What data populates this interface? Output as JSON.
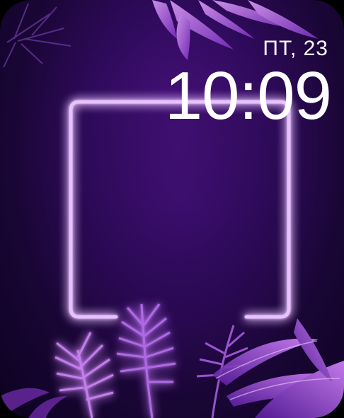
{
  "watch": {
    "date": "ПТ, 23",
    "time": "10:09"
  },
  "wallpaper": {
    "theme": "neon-frame-tropical-leaves",
    "colors": {
      "background": "#2e0a5a",
      "neon": "#d9a6ff",
      "neon_glow": "#b14dff",
      "leaf": "#b85ce6"
    }
  }
}
